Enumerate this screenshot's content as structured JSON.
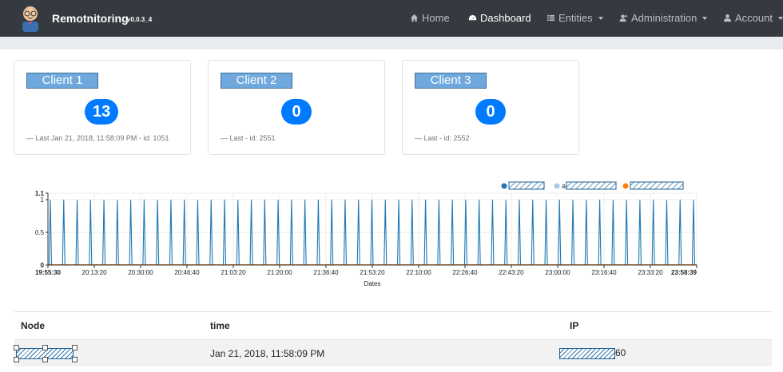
{
  "navbar": {
    "brand_name": "Remotnitoring",
    "brand_version": "v0.0.3_4",
    "items": [
      {
        "label": "Home",
        "icon": "home-icon"
      },
      {
        "label": "Dashboard",
        "icon": "dashboard-icon",
        "active": true
      },
      {
        "label": "Entities",
        "icon": "list-icon",
        "dropdown": true
      },
      {
        "label": "Administration",
        "icon": "user-plus-icon",
        "dropdown": true
      },
      {
        "label": "Account",
        "icon": "user-icon",
        "dropdown": true
      }
    ]
  },
  "cards": [
    {
      "title": "Client 1",
      "count": "13",
      "footer": "—   Last Jan 21, 2018, 11:58:09 PM - id: 1051"
    },
    {
      "title": "Client 2",
      "count": "0",
      "footer": "—   Last - id: 2551"
    },
    {
      "title": "Client 3",
      "count": "0",
      "footer": "—   Last - id: 2552"
    }
  ],
  "chart_data": {
    "type": "line",
    "xlabel": "Dates",
    "ylabel": "",
    "ylim": [
      0,
      1.1
    ],
    "yticks": [
      "0",
      "0.5",
      "1",
      "1.1"
    ],
    "xticks": [
      "19:55:30",
      "20:13:20",
      "20:30:00",
      "20:46:40",
      "21:03:20",
      "21:20:00",
      "21:36:40",
      "21:53:20",
      "22:10:00",
      "22:26:40",
      "22:43:20",
      "23:00:00",
      "23:16:40",
      "23:33:20",
      "23:58:39"
    ],
    "legend_position": "top-right",
    "series": [
      {
        "name": "",
        "color": "#1f77b4",
        "pattern": "spikes 0→1, about every 5 minutes",
        "spike_count": 49
      },
      {
        "name": "a",
        "color": "#aec7e8",
        "pattern": "flat 0"
      },
      {
        "name": "",
        "color": "#ff7f0e",
        "pattern": "flat 0"
      }
    ]
  },
  "table": {
    "headers": [
      "Node",
      "time",
      "IP"
    ],
    "rows": [
      {
        "node": "",
        "time": "Jan 21, 2018, 11:58:09 PM",
        "ip": "60"
      }
    ]
  }
}
